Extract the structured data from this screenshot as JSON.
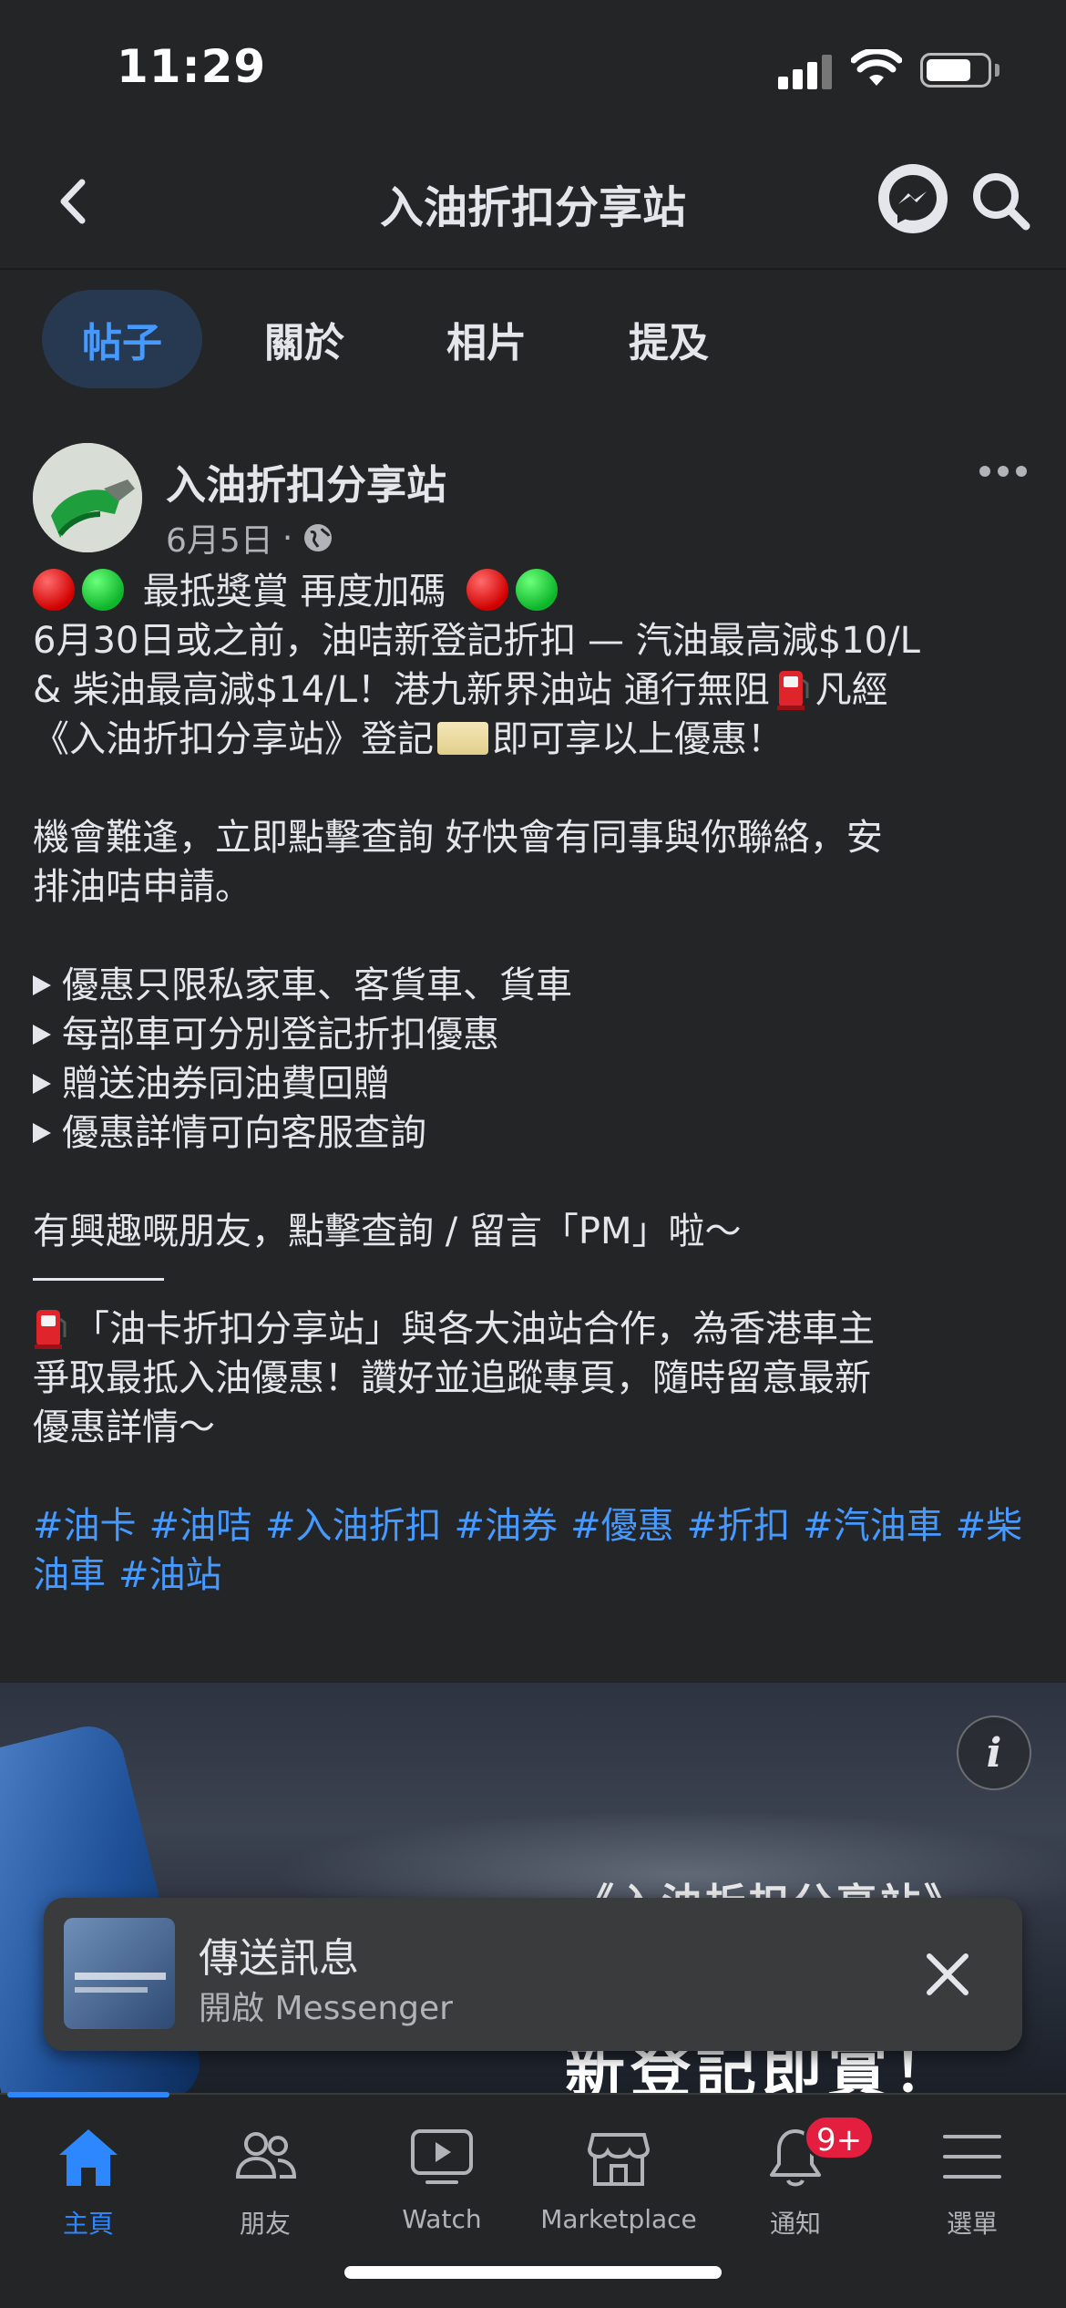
{
  "status_bar": {
    "time": "11:29"
  },
  "header": {
    "title": "入油折扣分享站"
  },
  "tabs": [
    {
      "label": "帖子",
      "active": true
    },
    {
      "label": "關於",
      "active": false
    },
    {
      "label": "相片",
      "active": false
    },
    {
      "label": "提及",
      "active": false
    }
  ],
  "post": {
    "page_name": "入油折扣分享站",
    "date": "6月5日",
    "meta_separator": "·",
    "line1": "最抵獎賞 再度加碼",
    "line2": "6月30日或之前，油咭新登記折扣 — 汽油最高減$10/L",
    "line3a": "& 柴油最高減$14/L！港九新界油站 通行無阻",
    "line3b": "凡經",
    "line4a": "《入油折扣分享站》登記",
    "line4b": "即可享以上優惠！",
    "para2_line1": "機會難逢，立即點擊查詢 好快會有同事與你聯絡，安",
    "para2_line2": "排油咭申請。",
    "bullets": [
      "優惠只限私家車、客貨車、貨車",
      "每部車可分別登記折扣優惠",
      "贈送油券同油費回贈",
      "優惠詳情可向客服查詢"
    ],
    "cta": "有興趣嘅朋友，點擊查詢 / 留言「PM」啦～",
    "about_line1": "「油卡折扣分享站」與各大油站合作，為香港車主",
    "about_line2": "爭取最抵入油優惠！讚好並追蹤專頁，隨時留意最新",
    "about_line3": "優惠詳情～",
    "hashtags": [
      "#油卡",
      "#油咭",
      "#入油折扣",
      "#油券",
      "#優惠",
      "#折扣",
      "#汽油車",
      "#柴油車",
      "#油站"
    ]
  },
  "post_image": {
    "title_top": "《入油折扣分享站》",
    "title_bottom": "新登記即賞！"
  },
  "toast": {
    "title": "傳送訊息",
    "subtitle": "開啟 Messenger"
  },
  "bottom_nav": [
    {
      "label": "主頁",
      "icon": "home-icon",
      "active": true
    },
    {
      "label": "朋友",
      "icon": "friends-icon",
      "active": false
    },
    {
      "label": "Watch",
      "icon": "watch-icon",
      "active": false
    },
    {
      "label": "Marketplace",
      "icon": "marketplace-icon",
      "active": false
    },
    {
      "label": "通知",
      "icon": "bell-icon",
      "active": false,
      "badge": "9+"
    },
    {
      "label": "選單",
      "icon": "menu-icon",
      "active": false
    }
  ],
  "colors": {
    "accent": "#2d88ff",
    "link": "#4599ff",
    "background": "#242526",
    "badge": "#e41e3f"
  }
}
